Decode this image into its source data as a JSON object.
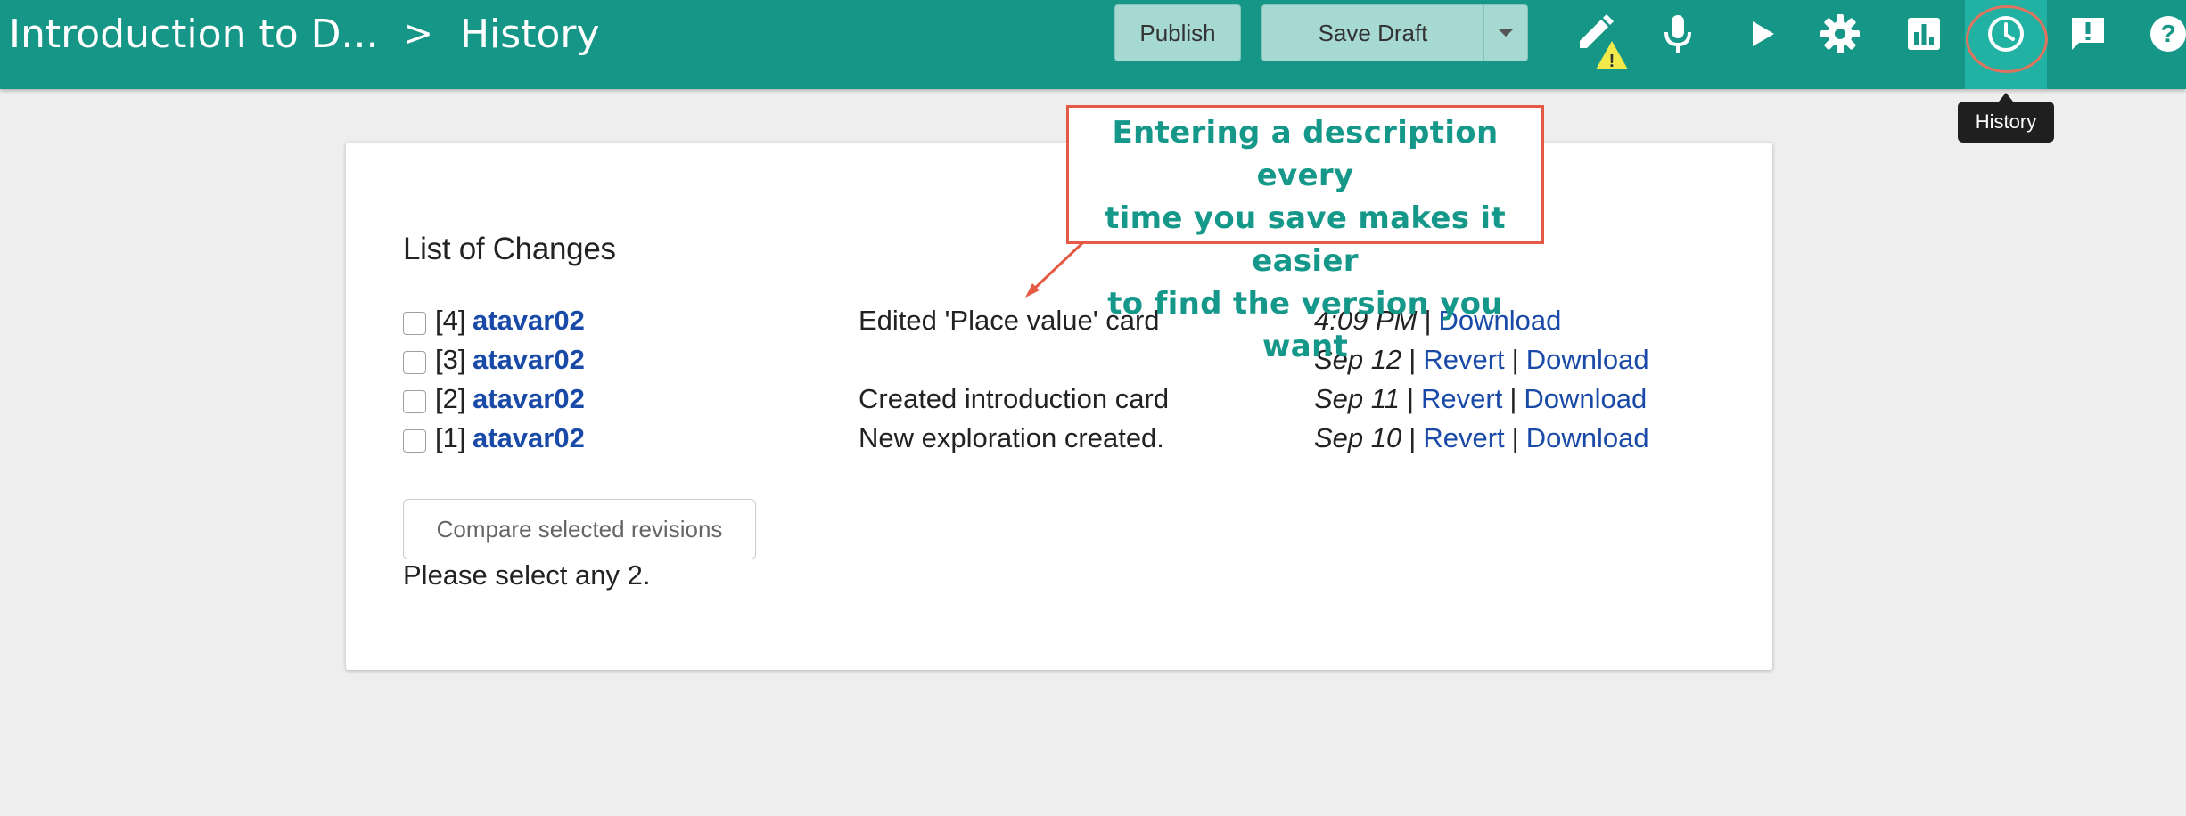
{
  "header": {
    "exploration_title": "Introduction to D...",
    "separator": ">",
    "current_tab": "History",
    "publish_label": "Publish",
    "save_draft_label": "Save Draft",
    "warning_badge": "!",
    "history_tooltip": "History"
  },
  "toolbar_icons": [
    "pencil-icon",
    "microphone-icon",
    "play-icon",
    "gear-icon",
    "bar-chart-icon",
    "history-clock-icon",
    "feedback-icon",
    "help-icon"
  ],
  "main": {
    "title": "List of Changes",
    "revisions": [
      {
        "version": "[4]",
        "user": "atavar02",
        "message": "Edited 'Place value' card",
        "date": "4:09 PM",
        "revert": "",
        "download": "Download"
      },
      {
        "version": "[3]",
        "user": "atavar02",
        "message": "",
        "date": "Sep 12",
        "revert": "Revert",
        "download": "Download"
      },
      {
        "version": "[2]",
        "user": "atavar02",
        "message": "Created introduction card",
        "date": "Sep 11",
        "revert": "Revert",
        "download": "Download"
      },
      {
        "version": "[1]",
        "user": "atavar02",
        "message": "New exploration created.",
        "date": "Sep 10",
        "revert": "Revert",
        "download": "Download"
      }
    ],
    "separator": "|",
    "compare_label": "Compare selected revisions",
    "hint": "Please select any 2."
  },
  "annotation": {
    "lines": [
      "Entering a description every",
      "time you save makes it easier",
      "to find the version you want"
    ]
  },
  "colors": {
    "topbar": "#159687",
    "link": "#1a4aa8",
    "annotation_text": "#15988a",
    "annotation_border": "#e55a45"
  }
}
